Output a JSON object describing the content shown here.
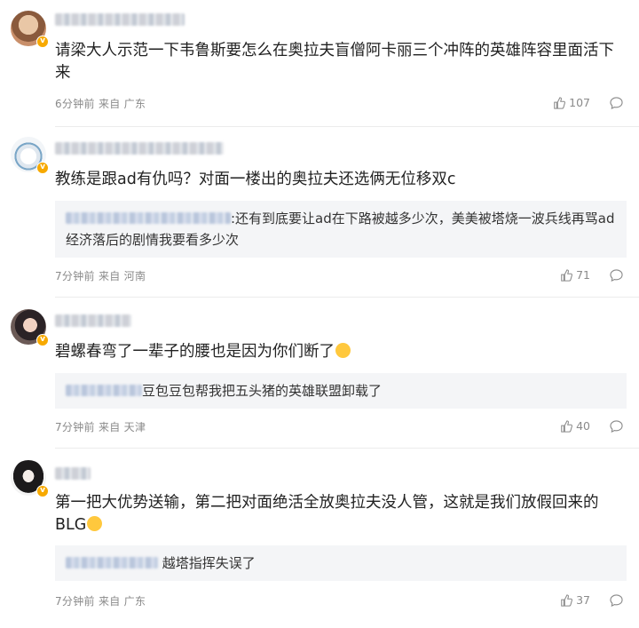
{
  "comments": [
    {
      "text": "请梁大人示范一下韦鲁斯要怎么在奥拉夫盲僧阿卡丽三个冲阵的英雄阵容里面活下来",
      "time": "6分钟前",
      "source": "来自 广东",
      "likes": "107"
    },
    {
      "text": "教练是跟ad有仇吗？对面一楼出的奥拉夫还选俩无位移双c",
      "reply": ":还有到底要让ad在下路被越多少次，美美被塔烧一波兵线再骂ad经济落后的剧情我要看多少次",
      "time": "7分钟前",
      "source": "来自 河南",
      "likes": "71"
    },
    {
      "text": "碧螺春弯了一辈子的腰也是因为你们断了",
      "reply": "豆包豆包帮我把五头猪的英雄联盟卸载了",
      "time": "7分钟前",
      "source": "来自 天津",
      "likes": "40"
    },
    {
      "text": "第一把大优势送输，第二把对面绝活全放奥拉夫没人管，这就是我们放假回来的BLG",
      "reply": "越塔指挥失误了",
      "time": "7分钟前",
      "source": "来自 广东",
      "likes": "37"
    }
  ],
  "colors": {
    "verified_badge": "#f7a900",
    "reply_bg": "#f4f5f7",
    "meta": "#8a8a8a"
  },
  "icons": [
    "thumbs-up-icon",
    "comment-icon",
    "verified-badge-icon",
    "laughing-emoji",
    "smile-emoji"
  ]
}
